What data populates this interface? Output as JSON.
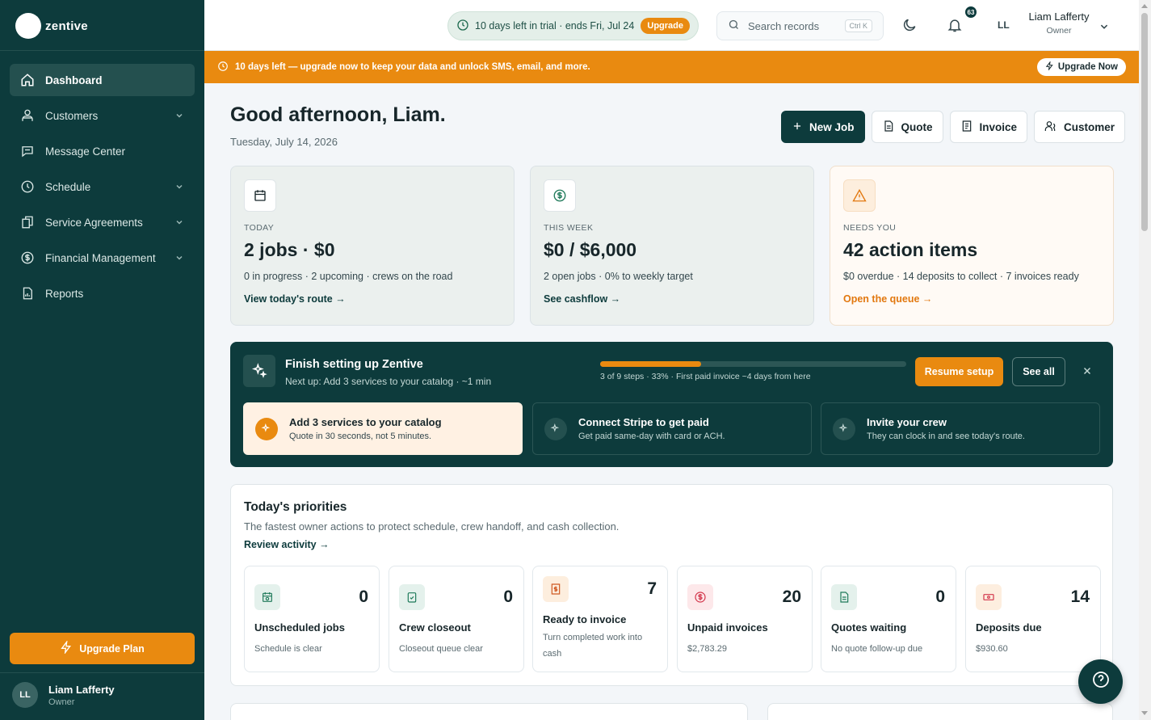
{
  "app": {
    "name": "zentive"
  },
  "colors": {
    "sidebar": "#0d3b3c",
    "accent": "#e98a10",
    "background": "#f3f6f9"
  },
  "sidebar": {
    "items": [
      {
        "label": "Dashboard",
        "icon": "home-icon",
        "active": true,
        "has_children": false
      },
      {
        "label": "Customers",
        "icon": "users-icon",
        "active": false,
        "has_children": true
      },
      {
        "label": "Message Center",
        "icon": "chat-icon",
        "active": false,
        "has_children": false
      },
      {
        "label": "Schedule",
        "icon": "clock-icon",
        "active": false,
        "has_children": true
      },
      {
        "label": "Service Agreements",
        "icon": "documents-icon",
        "active": false,
        "has_children": true
      },
      {
        "label": "Financial Management",
        "icon": "dollar-icon",
        "active": false,
        "has_children": true
      },
      {
        "label": "Reports",
        "icon": "report-icon",
        "active": false,
        "has_children": false
      }
    ],
    "upgrade_label": "Upgrade Plan",
    "user": {
      "initials": "LL",
      "name": "Liam Lafferty",
      "role": "Owner"
    }
  },
  "topbar": {
    "trial_text": "10 days left in trial · ends Fri, Jul 24",
    "trial_upgrade": "Upgrade",
    "search_placeholder": "Search records",
    "search_shortcut": "Ctrl K",
    "notifications_count": "63",
    "initials": "LL",
    "user_name": "Liam Lafferty",
    "user_role": "Owner"
  },
  "banner": {
    "text": "10 days left — upgrade now to keep your data and unlock SMS, email, and more.",
    "button": "Upgrade Now"
  },
  "greeting": {
    "title": "Good afternoon, Liam.",
    "date": "Tuesday, July 14, 2026"
  },
  "actions": {
    "new_job": "New Job",
    "quote": "Quote",
    "invoice": "Invoice",
    "customer": "Customer"
  },
  "stats": [
    {
      "label": "TODAY",
      "value": "2 jobs · $0",
      "sub": "0 in progress · 2 upcoming · crews on the road",
      "link": "View today's route →",
      "icon": "calendar-icon"
    },
    {
      "label": "THIS WEEK",
      "value": "$0 / $6,000",
      "sub": "2 open jobs · 0% to weekly target",
      "link": "See cashflow →",
      "icon": "dollar-icon"
    },
    {
      "label": "NEEDS YOU",
      "value": "42 action items",
      "sub": "$0 overdue · 14 deposits to collect · 7 invoices ready",
      "link": "Open the queue →",
      "icon": "warning-icon"
    }
  ],
  "setup": {
    "title": "Finish setting up Zentive",
    "next": "Next up: Add 3 services to your catalog · ~1 min",
    "progress": 0.33,
    "progress_text": "3 of 9 steps · 33% · First paid invoice ~4 days from here",
    "resume": "Resume setup",
    "see_all": "See all",
    "steps": [
      {
        "title": "Add 3 services to your catalog",
        "desc": "Quote in 30 seconds, not 5 minutes.",
        "current": true
      },
      {
        "title": "Connect Stripe to get paid",
        "desc": "Get paid same-day with card or ACH.",
        "current": false
      },
      {
        "title": "Invite your crew",
        "desc": "They can clock in and see today's route.",
        "current": false
      }
    ]
  },
  "priorities": {
    "title": "Today's priorities",
    "desc": "The fastest owner actions to protect schedule, crew handoff, and cash collection.",
    "link": "Review activity →",
    "cards": [
      {
        "title": "Unscheduled jobs",
        "count": "0",
        "sub": "Schedule is clear",
        "icon": "calendar-clock-icon",
        "tint": "#e4f1ec",
        "iconColor": "#1f7a5a"
      },
      {
        "title": "Crew closeout",
        "count": "0",
        "sub": "Closeout queue clear",
        "icon": "clipboard-check-icon",
        "tint": "#e4f1ec",
        "iconColor": "#1f7a5a"
      },
      {
        "title": "Ready to invoice",
        "count": "7",
        "sub": "Turn completed work into cash",
        "icon": "invoice-icon",
        "tint": "#fdeede",
        "iconColor": "#d05a23"
      },
      {
        "title": "Unpaid invoices",
        "count": "20",
        "sub": "$2,783.29",
        "icon": "dollar-circle-icon",
        "tint": "#fde8ea",
        "iconColor": "#d3364b"
      },
      {
        "title": "Quotes waiting",
        "count": "0",
        "sub": "No quote follow-up due",
        "icon": "document-icon",
        "tint": "#e4f1ec",
        "iconColor": "#1f7a5a"
      },
      {
        "title": "Deposits due",
        "count": "14",
        "sub": "$930.60",
        "icon": "banknote-icon",
        "tint": "#fdeedf",
        "iconColor": "#d3364b"
      }
    ]
  }
}
